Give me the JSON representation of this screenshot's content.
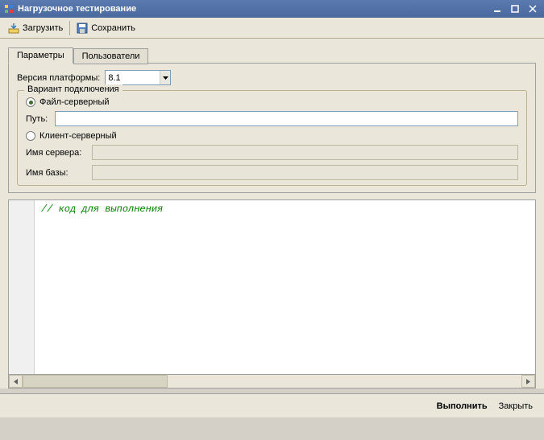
{
  "window": {
    "title": "Нагрузочное тестирование"
  },
  "toolbar": {
    "load": "Загрузить",
    "save": "Сохранить"
  },
  "tabs": {
    "params": "Параметры",
    "users": "Пользователи"
  },
  "form": {
    "platform_version_label": "Версия платформы:",
    "platform_version_value": "8.1",
    "fieldset_legend": "Вариант подключения",
    "radio_file_server": "Файл-серверный",
    "path_label": "Путь:",
    "path_value": "",
    "radio_client_server": "Клиент-серверный",
    "server_name_label": "Имя сервера:",
    "server_name_value": "",
    "base_name_label": "Имя базы:",
    "base_name_value": ""
  },
  "code": {
    "content": "// код для выполнения"
  },
  "footer": {
    "execute": "Выполнить",
    "close": "Закрыть"
  }
}
